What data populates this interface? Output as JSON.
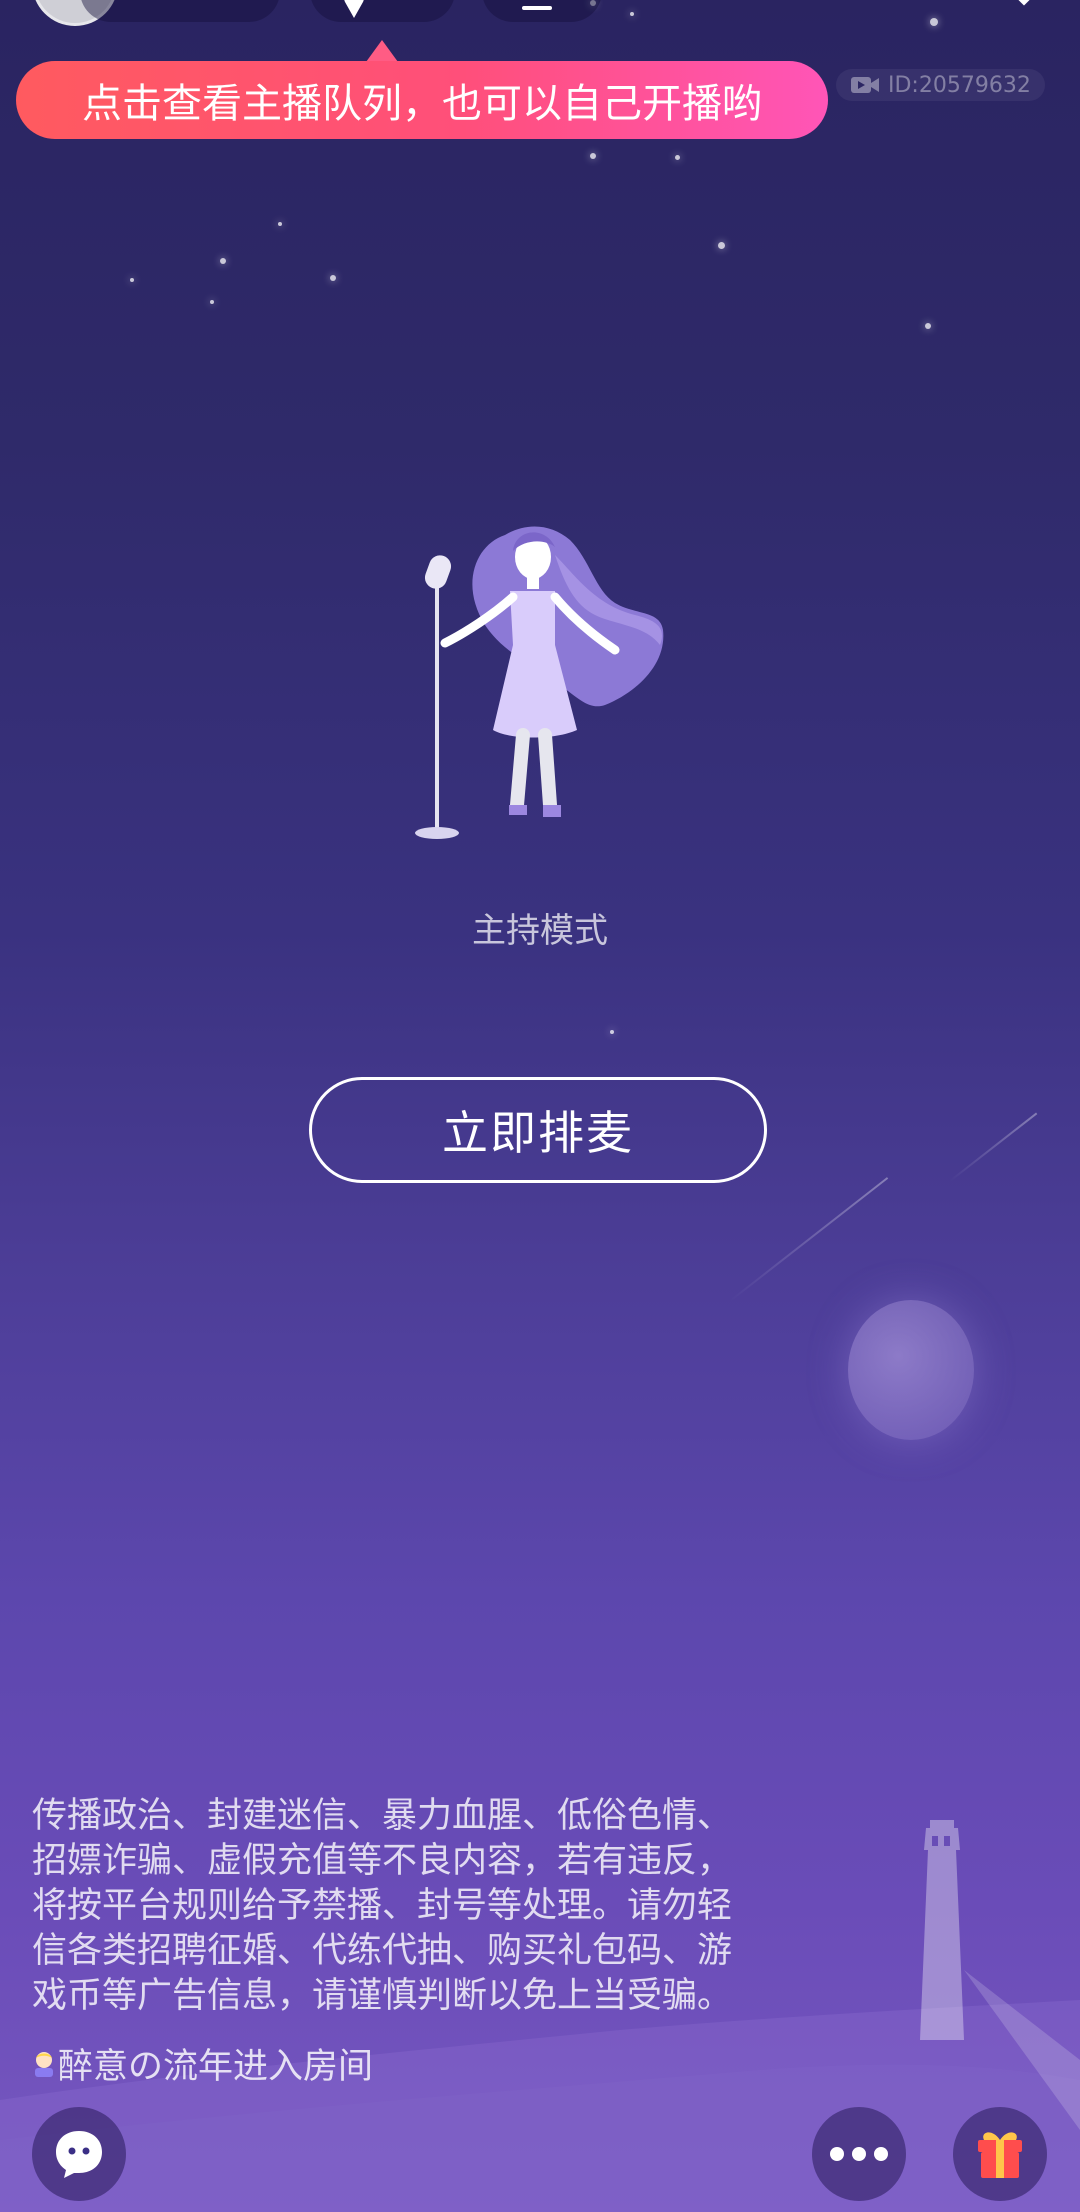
{
  "tooltip": {
    "text": "点击查看主播队列，也可以自己开播哟"
  },
  "room": {
    "id_label": "ID:20579632"
  },
  "host": {
    "mode_label": "主持模式",
    "queue_button_label": "立即排麦"
  },
  "notice": {
    "lines": [
      "传播政治、封建迷信、暴力血腥、低俗色情、",
      "招嫖诈骗、虚假充值等不良内容，若有违反，",
      "将按平台规则给予禁播、封号等处理。请勿轻",
      "信各类招聘征婚、代练代抽、购买礼包码、游",
      "戏币等广告信息，请谨慎判断以免上当受骗。"
    ]
  },
  "entry": {
    "username": "醉意の流年",
    "action": "进入房间"
  },
  "icons": {
    "chat": "chat-bubble-icon",
    "more": "more-dots-icon",
    "gift": "gift-icon",
    "close": "close-icon",
    "video": "video-camera-icon"
  },
  "colors": {
    "tooltip_start": "#ff5a5f",
    "tooltip_end": "#ff55b7",
    "gift_red": "#ff4d4d",
    "gift_gold": "#ffc64a"
  }
}
